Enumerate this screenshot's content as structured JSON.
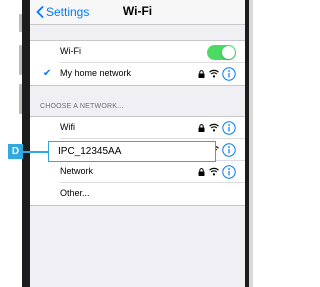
{
  "navbar": {
    "back_label": "Settings",
    "title": "Wi-Fi"
  },
  "wifi_toggle": {
    "label": "Wi-Fi",
    "state": "on",
    "on_color": "#4cd964"
  },
  "current_network": {
    "name": "My home network"
  },
  "choose_section": {
    "header": "CHOOSE A NETWORK..."
  },
  "networks": [
    {
      "name": "Wifi",
      "secured": true
    },
    {
      "name": "IPC_12345AA",
      "secured": true,
      "highlighted": true
    },
    {
      "name": "Network",
      "secured": true
    }
  ],
  "other_option": {
    "label": "Other..."
  },
  "callout": {
    "tag": "D",
    "color": "#31a8e0"
  },
  "colors": {
    "accent": "#007aff",
    "background": "#efeff4"
  }
}
